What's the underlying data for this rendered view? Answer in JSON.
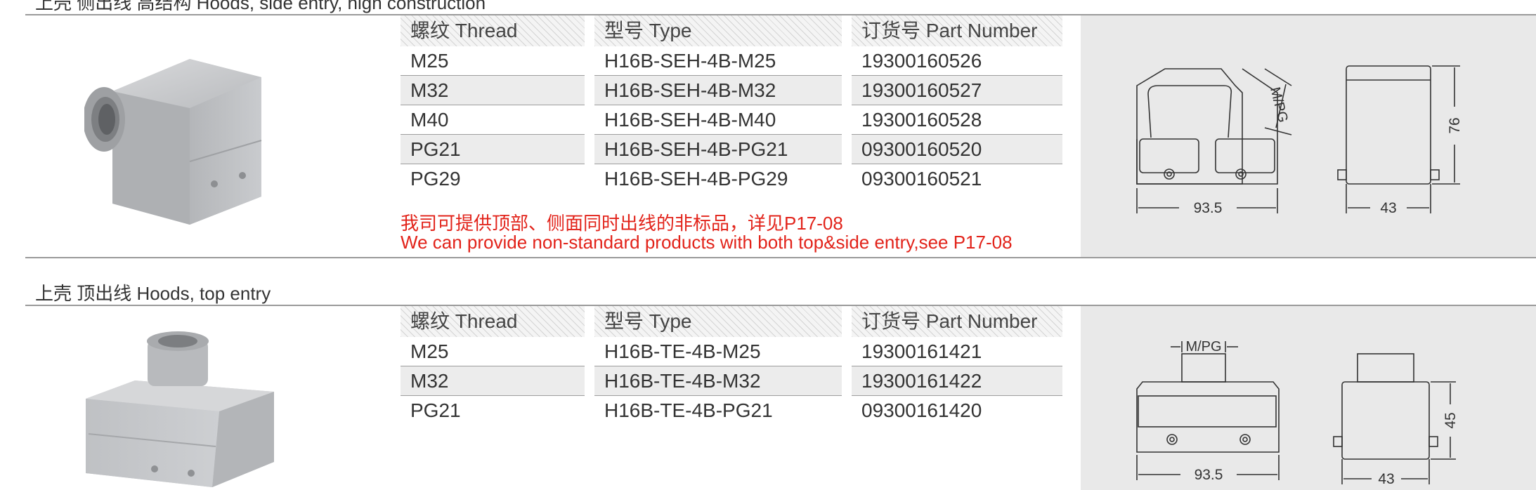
{
  "section1": {
    "title": "上壳 侧出线 高结构 Hoods, side entry, high construction",
    "headers": {
      "thread": "螺纹 Thread",
      "type": "型号 Type",
      "part": "订货号 Part Number"
    },
    "rows": [
      {
        "thread": "M25",
        "type": "H16B-SEH-4B-M25",
        "part": "19300160526"
      },
      {
        "thread": "M32",
        "type": "H16B-SEH-4B-M32",
        "part": "19300160527"
      },
      {
        "thread": "M40",
        "type": "H16B-SEH-4B-M40",
        "part": "19300160528"
      },
      {
        "thread": "PG21",
        "type": "H16B-SEH-4B-PG21",
        "part": "09300160520"
      },
      {
        "thread": "PG29",
        "type": "H16B-SEH-4B-PG29",
        "part": "09300160521"
      }
    ],
    "note_cn": "我司可提供顶部、侧面同时出线的非标品，详见P17-08",
    "note_en": "We can provide non-standard products with both top&side entry,see P17-08",
    "drawing": {
      "label_mpg": "M/PG",
      "width": "93.5",
      "height": "76",
      "depth": "43"
    }
  },
  "section2": {
    "title": "上壳 顶出线  Hoods, top entry",
    "headers": {
      "thread": "螺纹 Thread",
      "type": "型号 Type",
      "part": "订货号 Part Number"
    },
    "rows": [
      {
        "thread": "M25",
        "type": "H16B-TE-4B-M25",
        "part": "19300161421"
      },
      {
        "thread": "M32",
        "type": "H16B-TE-4B-M32",
        "part": "19300161422"
      },
      {
        "thread": "PG21",
        "type": "H16B-TE-4B-PG21",
        "part": "09300161420"
      }
    ],
    "drawing": {
      "label_mpg": "M/PG",
      "width": "93.5",
      "height": "45",
      "depth": "43"
    }
  },
  "colors": {
    "note_red": "#e2231a",
    "panel_gray": "#e9e9e9",
    "rule_gray": "#9a9a9a"
  }
}
